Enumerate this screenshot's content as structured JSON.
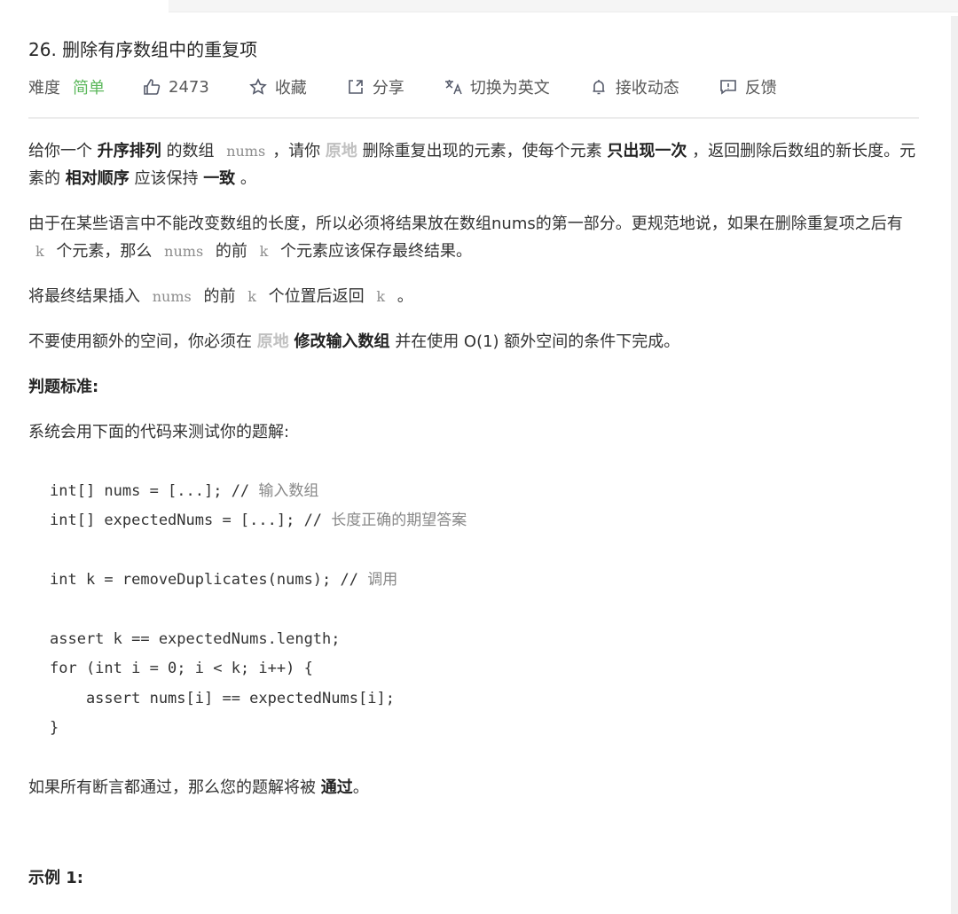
{
  "problem": {
    "title": "26. 删除有序数组中的重复项",
    "difficulty_label": "难度",
    "difficulty_value": "简单",
    "difficulty_color": "#5cb85c"
  },
  "actions": [
    {
      "icon": "thumbs-up-icon",
      "label": "2473"
    },
    {
      "icon": "star-icon",
      "label": "收藏"
    },
    {
      "icon": "share-icon",
      "label": "分享"
    },
    {
      "icon": "translate-icon",
      "label": "切换为英文"
    },
    {
      "icon": "bell-icon",
      "label": "接收动态"
    },
    {
      "icon": "feedback-icon",
      "label": "反馈"
    }
  ],
  "description": {
    "p1": {
      "t1": "给你一个 ",
      "b1": "升序排列",
      "t2": " 的数组 ",
      "c1": "nums",
      "t3": "，请你 ",
      "f1": "原地",
      "t4": " 删除重复出现的元素，使每个元素 ",
      "b2": "只出现一次",
      "t5": " ，返回删除后数组的新长度。元素的 ",
      "b3": "相对顺序",
      "t6": " 应该保持 ",
      "b4": "一致",
      "t7": " 。"
    },
    "p2": {
      "t1": "由于在某些语言中不能改变数组的长度，所以必须将结果放在数组nums的第一部分。更规范地说，如果在删除重复项之后有 ",
      "c1": "k",
      "t2": " 个元素，那么 ",
      "c2": "nums",
      "t3": " 的前 ",
      "c3": "k",
      "t4": " 个元素应该保存最终结果。"
    },
    "p3": {
      "t1": "将最终结果插入 ",
      "c1": "nums",
      "t2": " 的前 ",
      "c2": "k",
      "t3": " 个位置后返回 ",
      "c3": "k",
      "t4": " 。"
    },
    "p4": {
      "t1": "不要使用额外的空间，你必须在 ",
      "f1": "原地",
      "t2": " ",
      "b1": "修改输入数组",
      "t3": " 并在使用 O(1) 额外空间的条件下完成。"
    },
    "judge_heading": "判题标准:",
    "judge_intro": "系统会用下面的代码来测试你的题解:"
  },
  "code_lines": [
    {
      "code": "int[] nums = [...]; // ",
      "comment": "输入数组"
    },
    {
      "code": "int[] expectedNums = [...]; // ",
      "comment": "长度正确的期望答案"
    },
    {
      "code": "",
      "comment": ""
    },
    {
      "code": "int k = removeDuplicates(nums); // ",
      "comment": "调用"
    },
    {
      "code": "",
      "comment": ""
    },
    {
      "code": "assert k == expectedNums.length;",
      "comment": ""
    },
    {
      "code": "for (int i = 0; i < k; i++) {",
      "comment": ""
    },
    {
      "code": "    assert nums[i] == expectedNums[i];",
      "comment": ""
    },
    {
      "code": "}",
      "comment": ""
    }
  ],
  "pass_text": {
    "t1": "如果所有断言都通过，那么您的题解将被 ",
    "b1": "通过",
    "t2": "。"
  },
  "example_heading": "示例 1:"
}
